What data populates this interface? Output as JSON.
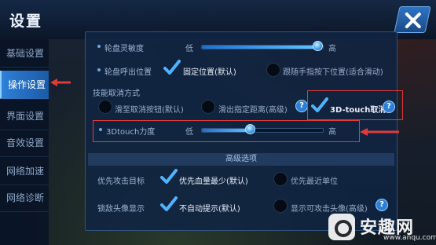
{
  "header": {
    "title": "设置"
  },
  "sidebar": {
    "items": [
      {
        "label": "基础设置"
      },
      {
        "label": "操作设置",
        "active": true
      },
      {
        "label": "界面设置"
      },
      {
        "label": "音效设置"
      },
      {
        "label": "网络加速"
      },
      {
        "label": "网络诊断"
      }
    ]
  },
  "joystick": {
    "sensitivity": {
      "label": "轮盘灵敏度",
      "low": "低",
      "high": "高",
      "level": 0.93
    },
    "position": {
      "label": "轮盘呼出位置",
      "options": [
        {
          "label": "固定位置(默认)",
          "selected": true
        },
        {
          "label": "跟随手指按下位置(适合滑动)",
          "selected": false
        }
      ]
    }
  },
  "skill_cancel": {
    "label": "技能取消方式",
    "options": [
      {
        "label": "滑至取消按钮(默认)",
        "selected": false
      },
      {
        "label": "滑出指定距离(高级)",
        "selected": false
      },
      {
        "label": "3D-touch取消",
        "selected": true
      }
    ],
    "help_symbol": "?"
  },
  "touch3d": {
    "label": "3Dtouch力度",
    "low": "低",
    "high": "高",
    "level": 0.4
  },
  "advanced": {
    "title": "高级选项",
    "attack_target": {
      "label": "优先攻击目标",
      "options": [
        {
          "label": "优先血量最少(默认)",
          "selected": true
        },
        {
          "label": "优先最近单位",
          "selected": false
        }
      ]
    },
    "lock_avatar": {
      "label": "锁敌头像显示",
      "options": [
        {
          "label": "不自动提示(默认)",
          "selected": true
        },
        {
          "label": "显示可攻击头像(高级)",
          "selected": false
        }
      ],
      "help_symbol": "?"
    }
  },
  "watermark": {
    "brand": "安趣网",
    "url": "www.anqu.com"
  },
  "colors": {
    "accent": "#2e80d8",
    "highlight": "#e23a3a",
    "check": "#4fb4ff"
  },
  "icons": {
    "close": "close-icon",
    "check": "check-icon",
    "help": "help-icon",
    "arrow": "arrow-left-icon"
  }
}
